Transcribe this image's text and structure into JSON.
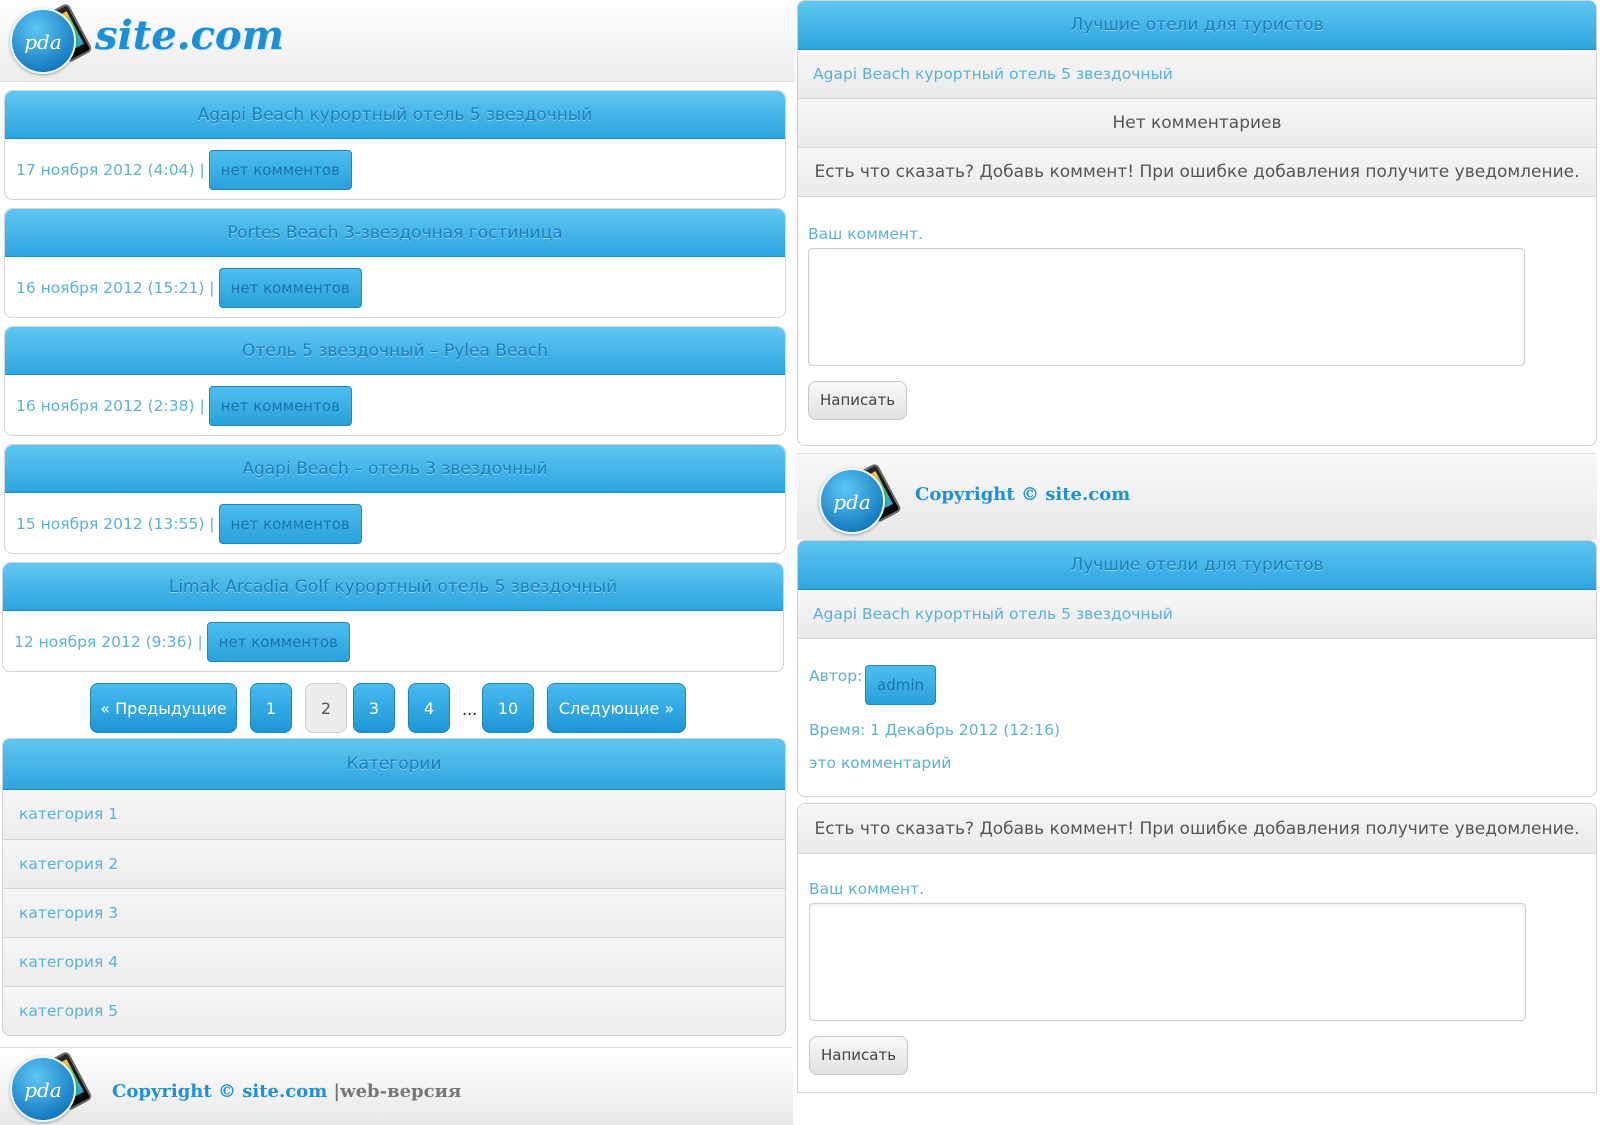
{
  "header": {
    "brand": "site.com",
    "logo_text": "pda"
  },
  "articles": [
    {
      "title": "Agapi Beach курортный отель 5 звездочный",
      "date": "17 ноября 2012 (4:04) |",
      "comments": "нет комментов"
    },
    {
      "title": "Portes Beach 3-звездочная гостиница",
      "date": "16 ноября 2012 (15:21) |",
      "comments": "нет комментов"
    },
    {
      "title": "Отель 5 звездочный – Pylea Beach",
      "date": "16 ноября 2012 (2:38) |",
      "comments": "нет комментов"
    },
    {
      "title": "Agapi Beach – отель 3 звездочный",
      "date": "15 ноября 2012 (13:55) |",
      "comments": "нет комментов"
    },
    {
      "title": "Limak Arcadia Golf курортный отель 5 звездочный",
      "date": "12 ноября 2012 (9:36) |",
      "comments": "нет комментов"
    }
  ],
  "pagination": {
    "prev": "« Предыдущие",
    "pages": [
      "1",
      "2",
      "3",
      "4",
      "10"
    ],
    "current": "2",
    "ellipsis": "...",
    "next": "Следующие »"
  },
  "categories": {
    "title": "Категории",
    "items": [
      "категория 1",
      "категория 2",
      "категория 3",
      "категория 4",
      "категория 5"
    ]
  },
  "footer_left": {
    "copyright": "Copyright © site.com",
    "separator": " |",
    "web_version": "web-версия"
  },
  "right_top": {
    "title": "Лучшие отели для туристов",
    "post_link": "Agapi Beach курортный отель 5 звездочный",
    "no_comments": "Нет комментариев",
    "prompt": "Есть что сказать? Добавь коммент! При ошибке добавления получите уведомление.",
    "comment_label": "Ваш коммент.",
    "submit": "Написать"
  },
  "footer_right": {
    "copyright": "Copyright © site.com"
  },
  "right_bottom": {
    "title": "Лучшие отели для туристов",
    "post_link": "Agapi Beach курортный отель 5 звездочный",
    "author_label": "Автор:",
    "author": "admin",
    "time": "Время: 1 Декабрь 2012 (12:16)",
    "comment_text": "это комментарий",
    "prompt": "Есть что сказать? Добавь коммент! При ошибке добавления получите уведомление.",
    "comment_label": "Ваш коммент.",
    "submit": "Написать"
  }
}
